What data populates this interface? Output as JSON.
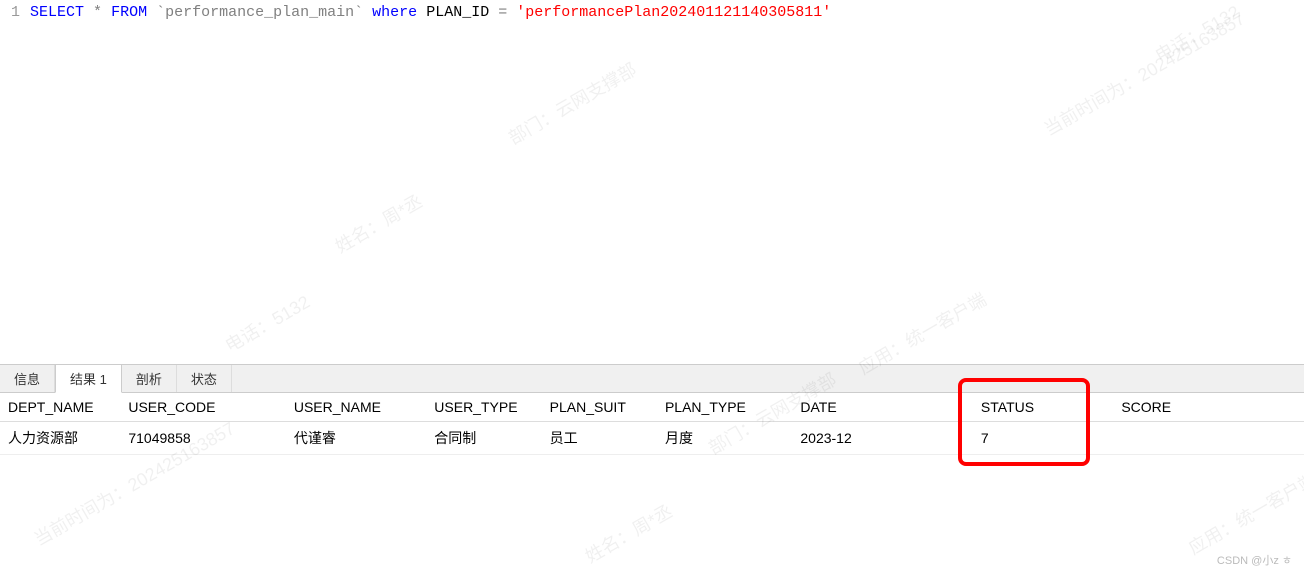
{
  "editor": {
    "line_number": "1",
    "kw_select": "SELECT",
    "star": "*",
    "kw_from": "FROM",
    "table": "`performance_plan_main`",
    "kw_where": "where",
    "column": "PLAN_ID",
    "equals": "=",
    "value": "'performancePlan202401121140305811'"
  },
  "tabs": {
    "info": "信息",
    "result": "结果 1",
    "profile": "剖析",
    "status": "状态"
  },
  "table": {
    "headers": {
      "dept_name": "DEPT_NAME",
      "user_code": "USER_CODE",
      "user_name": "USER_NAME",
      "user_type": "USER_TYPE",
      "plan_suit": "PLAN_SUIT",
      "plan_type": "PLAN_TYPE",
      "date": "DATE",
      "status": "STATUS",
      "score": "SCORE"
    },
    "rows": [
      {
        "dept_name": "人力资源部",
        "user_code": "71049858",
        "user_name": "代谨睿",
        "user_type": "合同制",
        "plan_suit": "员工",
        "plan_type": "月度",
        "date": "2023-12",
        "status": "7",
        "score": ""
      }
    ]
  },
  "footer": {
    "credit": "CSDN @小z ㅎ"
  },
  "watermarks": {
    "w1": "当前时间为：202425163857",
    "w2": "部门：云网支撑部",
    "w3": "姓名：周*丞",
    "w4": "电话：5132",
    "w5": "应用：统一客户端"
  }
}
